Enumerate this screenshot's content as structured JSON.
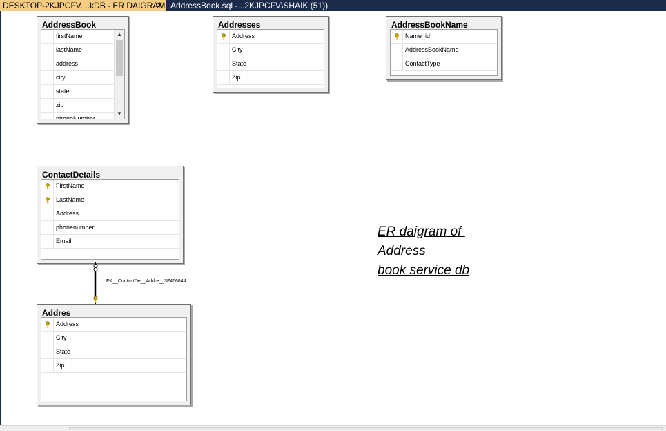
{
  "tabs": [
    {
      "label": "DESKTOP-2KJPCFV....kDB - ER DAIGRAM",
      "active": true,
      "close": "✕"
    },
    {
      "label": "AddressBook.sql -...2KJPCFV\\SHAIK (51))",
      "active": false
    }
  ],
  "tables": {
    "addressbook": {
      "title": "AddressBook",
      "columns": [
        "firstName",
        "lastName",
        "address",
        "city",
        "state",
        "zip",
        "phoneNumber"
      ],
      "scroll_up": "▲",
      "scroll_down": "▼"
    },
    "addresses": {
      "title": "Addresses",
      "columns": [
        "Address",
        "City",
        "State",
        "Zip"
      ]
    },
    "addressbookname": {
      "title": "AddressBookName",
      "columns": [
        "Name_id",
        "AddressBookName",
        "ContactType"
      ]
    },
    "contactdetails": {
      "title": "ContactDetails",
      "columns": [
        "FirstName",
        "LastName",
        "Address",
        "phonenumber",
        "Email"
      ]
    },
    "addres": {
      "title": "Addres",
      "columns": [
        "Address",
        "City",
        "State",
        "Zip"
      ]
    }
  },
  "relationship": {
    "label": "FK__ContactDe__Addre__3F466844"
  },
  "note": {
    "line1": "ER daigram of ",
    "line2": "Address ",
    "line3": "book service db"
  },
  "icons": {
    "primary_key": "key-icon",
    "key_color": "#d4a800"
  }
}
